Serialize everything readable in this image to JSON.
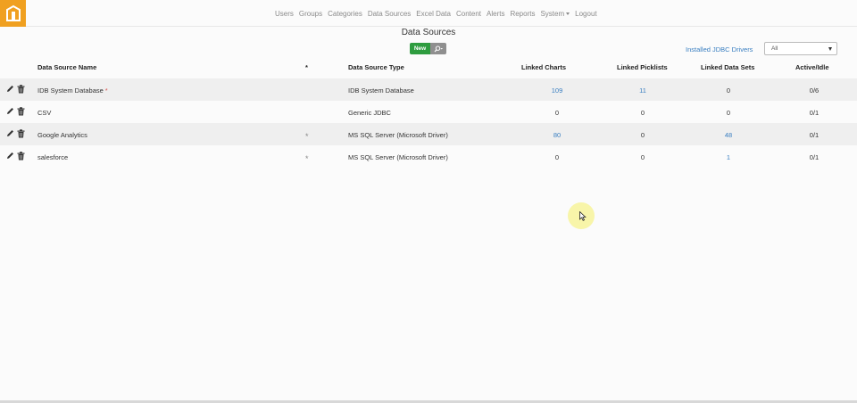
{
  "nav": {
    "items": [
      "Users",
      "Groups",
      "Categories",
      "Data Sources",
      "Excel Data",
      "Content",
      "Alerts",
      "Reports",
      "System",
      "Logout"
    ]
  },
  "page": {
    "title": "Data Sources",
    "new_label": "New",
    "jdbc_link": "Installed JDBC Drivers",
    "filter_value": "All"
  },
  "table": {
    "headers": {
      "name": "Data Source Name",
      "star": "*",
      "type": "Data Source Type",
      "charts": "Linked Charts",
      "picklists": "Linked Picklists",
      "datasets": "Linked Data Sets",
      "active": "Active/Idle"
    },
    "rows": [
      {
        "name": "IDB System Database",
        "required": "*",
        "star": "",
        "type": "IDB System Database",
        "charts": "109",
        "picklists": "11",
        "datasets": "0",
        "active": "0/6"
      },
      {
        "name": "CSV",
        "required": "",
        "star": "",
        "type": "Generic JDBC",
        "charts": "0",
        "picklists": "0",
        "datasets": "0",
        "active": "0/1"
      },
      {
        "name": "Google Analytics",
        "required": "",
        "star": "*",
        "type": "MS SQL Server (Microsoft Driver)",
        "charts": "80",
        "picklists": "0",
        "datasets": "48",
        "active": "0/1"
      },
      {
        "name": "salesforce",
        "required": "",
        "star": "*",
        "type": "MS SQL Server (Microsoft Driver)",
        "charts": "0",
        "picklists": "0",
        "datasets": "1",
        "active": "0/1"
      }
    ]
  },
  "colors": {
    "accent": "#f0a020",
    "link": "#3a7fc1",
    "new_button": "#2e9c3f",
    "required": "#d9534f"
  },
  "icons": [
    "app-logo-icon",
    "search-icon",
    "pencil-icon",
    "trash-icon",
    "mouse-cursor-icon"
  ]
}
